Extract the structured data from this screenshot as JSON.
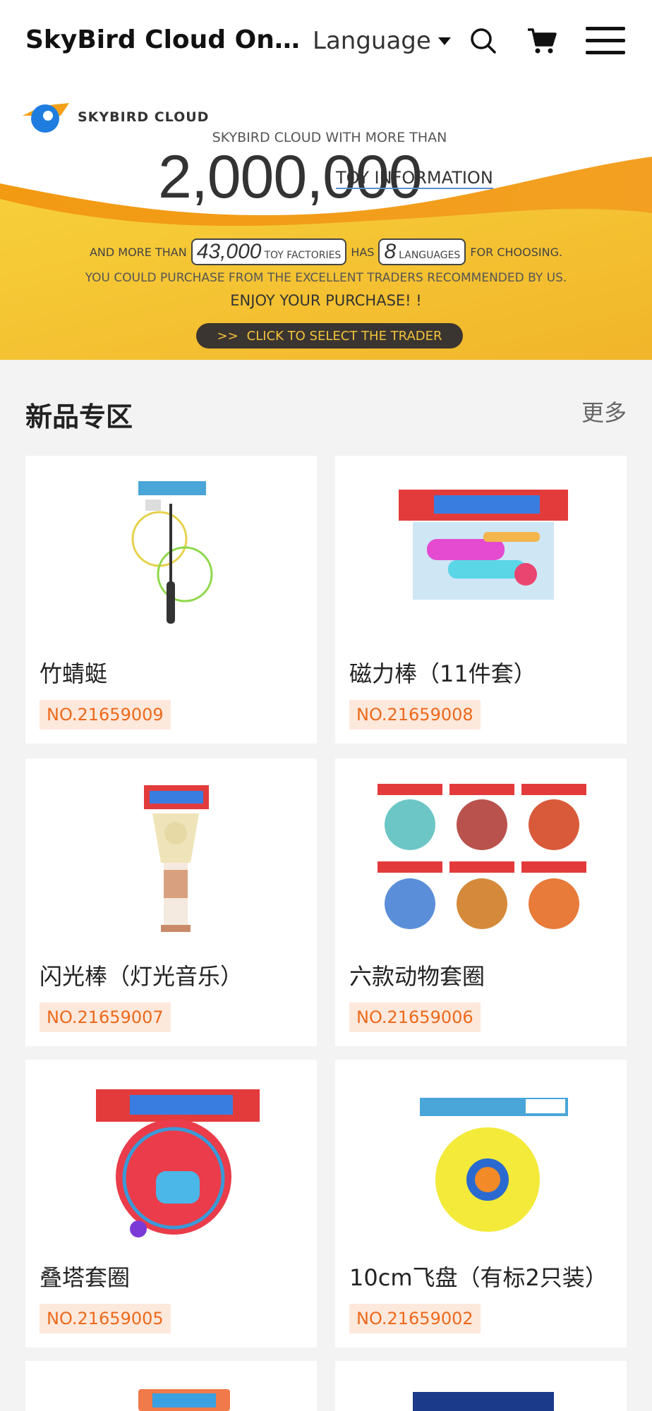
{
  "header": {
    "title": "SkyBird Cloud Online",
    "language_label": "Language",
    "icons": [
      "search-icon",
      "cart-icon",
      "menu-icon"
    ]
  },
  "banner": {
    "logo_text": "SKYBIRD CLOUD",
    "line1": "SKYBIRD CLOUD WITH MORE THAN",
    "big_number": "2,000,000",
    "toy_information": "TOY INFORMATION",
    "and_more_than": "AND MORE THAN",
    "factories_number": "43,000",
    "factories_label": "TOY FACTORIES",
    "has": "HAS",
    "languages_number": "8",
    "languages_label": "LANGUAGES",
    "for_choosing": "FOR CHOOSING.",
    "line4": "YOU COULD PURCHASE FROM THE EXCELLENT TRADERS RECOMMENDED BY US.",
    "line5": "ENJOY YOUR PURCHASE! !",
    "cta_arrows": ">>",
    "cta_label": "CLICK TO SELECT THE TRADER",
    "colors": {
      "accent": "#f2a51c",
      "yellow": "#f6c431",
      "cta_bg": "#3a3530"
    }
  },
  "section": {
    "title": "新品专区",
    "more": "更多"
  },
  "products": [
    {
      "name": "竹蜻蜓",
      "code": "NO.21659009"
    },
    {
      "name": "磁力棒（11件套）",
      "code": "NO.21659008"
    },
    {
      "name": "闪光棒（灯光音乐）",
      "code": "NO.21659007"
    },
    {
      "name": "六款动物套圈",
      "code": "NO.21659006"
    },
    {
      "name": "叠塔套圈",
      "code": "NO.21659005"
    },
    {
      "name": "10cm飞盘（有标2只装）",
      "code": "NO.21659002"
    }
  ],
  "colors": {
    "code_text": "#ec6a1c",
    "code_bg": "#fde8dc",
    "page_bg": "#f3f3f3"
  }
}
